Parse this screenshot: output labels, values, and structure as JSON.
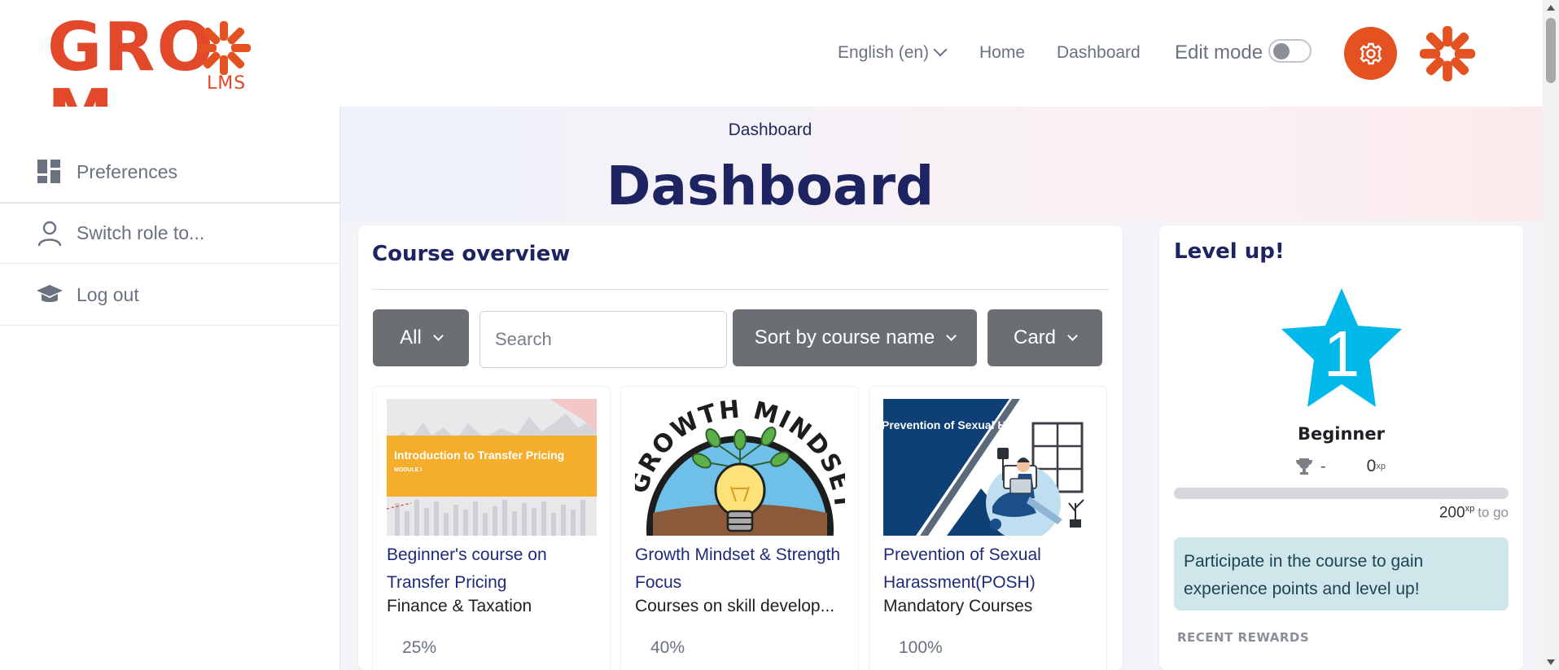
{
  "brand": {
    "logo_main": "GRO",
    "logo_tail": "M",
    "logo_sub": "LMS",
    "accent": "#e45222"
  },
  "header": {
    "language": "English (en)",
    "nav_home": "Home",
    "nav_dashboard": "Dashboard",
    "edit_mode_label": "Edit mode",
    "edit_mode_on": false,
    "gear_icon": "gear-icon",
    "avatar_icon": "brand-burst-icon"
  },
  "sidebar": {
    "items": [
      {
        "label": "Preferences",
        "icon": "dashboard-grid-icon"
      },
      {
        "label": "Switch role to...",
        "icon": "user-icon"
      },
      {
        "label": "Log out",
        "icon": "graduation-cap-icon"
      }
    ]
  },
  "page": {
    "breadcrumb": "Dashboard",
    "title": "Dashboard"
  },
  "course_overview": {
    "title": "Course overview",
    "filter_label": "All",
    "search_placeholder": "Search",
    "sort_label": "Sort by course name",
    "view_label": "Card",
    "courses": [
      {
        "name": "Beginner's course on Transfer Pricing",
        "category": "Finance & Taxation",
        "progress": "25%",
        "thumb_title": "Introduction to Transfer Pricing",
        "thumb_sub": "MODULE I"
      },
      {
        "name": "Growth Mindset & Strength Focus",
        "category": "Courses on skill develop...",
        "progress": "40%",
        "thumb_title": "GROWTH MINDSET"
      },
      {
        "name": "Prevention of Sexual Harassment(POSH)",
        "category": "Mandatory Courses",
        "progress": "100%",
        "thumb_title": "Prevention of Sexual Harassment"
      }
    ]
  },
  "level_up": {
    "title": "Level up!",
    "level_number": "1",
    "level_name": "Beginner",
    "rank": "-",
    "xp_value": "0",
    "xp_unit": "xp",
    "progress_fraction": 0.0,
    "to_go_value": "200",
    "to_go_label": "to go",
    "info_text": "Participate in the course to gain experience points and level up!",
    "recent_rewards_label": "RECENT REWARDS",
    "star_color": "#00b8ea"
  }
}
